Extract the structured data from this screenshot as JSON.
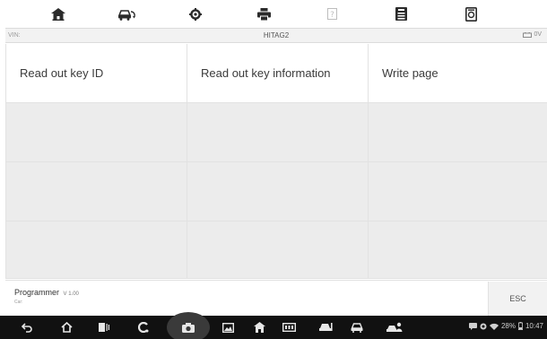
{
  "info_bar": {
    "vin_label": "VIN:",
    "title": "HITAG2",
    "battery_voltage": "0V"
  },
  "functions": [
    {
      "label": "Read out key ID"
    },
    {
      "label": "Read out key information"
    },
    {
      "label": "Write page"
    }
  ],
  "footer": {
    "program_name": "Programmer",
    "version": "V 1.00",
    "car_label": "Car:",
    "esc_label": "ESC"
  },
  "status_bar": {
    "battery_percent": "28%",
    "time": "10:47"
  },
  "toolbar_icons": [
    "home-icon",
    "vehicle-swap-icon",
    "settings-icon",
    "print-icon",
    "help-icon",
    "save-icon",
    "data-manager-icon"
  ]
}
